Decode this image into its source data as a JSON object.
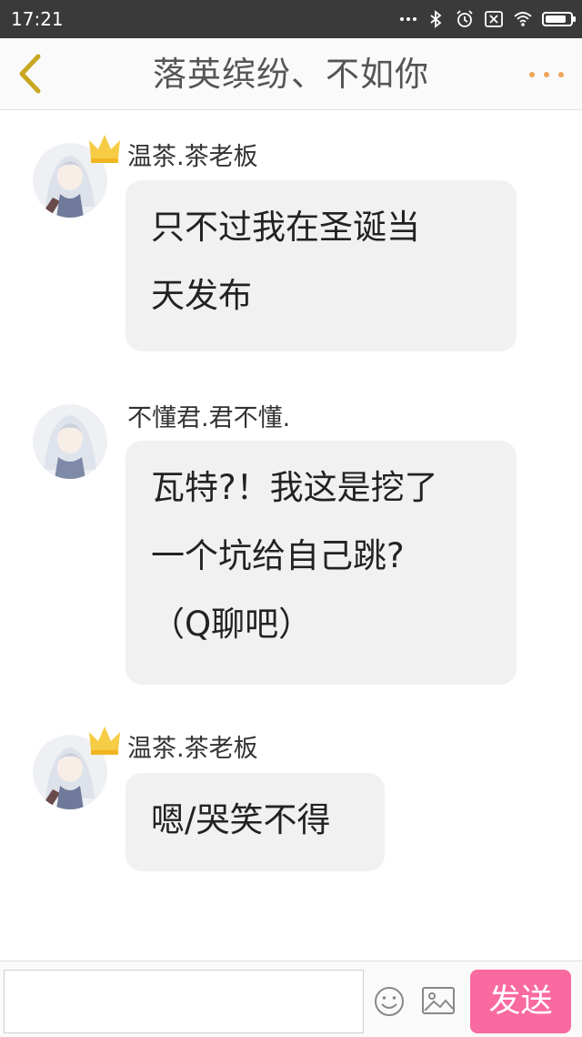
{
  "status_bar": {
    "time": "17:21",
    "battery_level": 0.85
  },
  "header": {
    "title": "落英缤纷、不如你",
    "accent_color": "#f0a45a"
  },
  "messages": [
    {
      "sender": "温茶.茶老板",
      "has_crown": true,
      "lines": [
        "只不过我在圣诞当",
        "天发布"
      ]
    },
    {
      "sender": "不懂君.君不懂.",
      "has_crown": false,
      "lines": [
        "瓦特?！我这是挖了",
        "一个坑给自己跳?",
        "（Q聊吧）"
      ]
    },
    {
      "sender": "温茶.茶老板",
      "has_crown": true,
      "lines": [
        "嗯/哭笑不得"
      ]
    }
  ],
  "input": {
    "value": "",
    "placeholder": ""
  },
  "send_label": "发送",
  "send_color": "#f96aa0",
  "icons": [
    "back-arrow-icon",
    "more-icon",
    "crown-icon",
    "emoji-icon",
    "image-icon",
    "bluetooth-icon",
    "alarm-icon",
    "wifi-icon",
    "battery-icon"
  ]
}
